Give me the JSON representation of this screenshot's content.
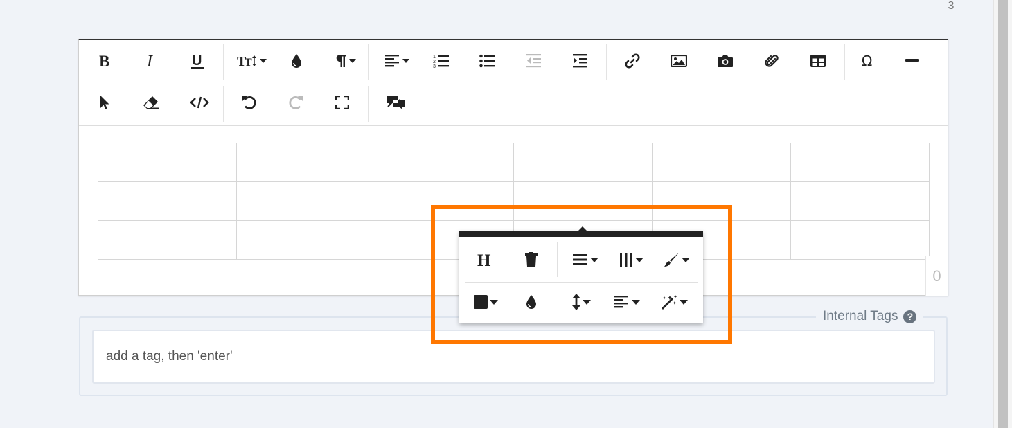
{
  "page": {
    "corner_number": "3"
  },
  "toolbar": {
    "row1": [
      {
        "icon": "bold-icon"
      },
      {
        "icon": "italic-icon"
      },
      {
        "icon": "underline-icon"
      },
      {
        "icon": "font-size-icon",
        "dropdown": true
      },
      {
        "icon": "color-drop-icon"
      },
      {
        "icon": "paragraph-icon",
        "dropdown": true
      },
      {
        "icon": "align-left-icon",
        "dropdown": true
      },
      {
        "icon": "ordered-list-icon"
      },
      {
        "icon": "unordered-list-icon"
      },
      {
        "icon": "outdent-icon",
        "disabled": true
      },
      {
        "icon": "indent-icon"
      },
      {
        "icon": "link-icon"
      },
      {
        "icon": "image-icon"
      },
      {
        "icon": "camera-icon"
      },
      {
        "icon": "paperclip-icon"
      },
      {
        "icon": "table-icon"
      },
      {
        "icon": "omega-icon"
      },
      {
        "icon": "horizontal-rule-icon"
      }
    ],
    "row2": [
      {
        "icon": "cursor-icon"
      },
      {
        "icon": "eraser-icon"
      },
      {
        "icon": "code-view-icon"
      },
      {
        "icon": "undo-icon"
      },
      {
        "icon": "redo-icon",
        "disabled": true
      },
      {
        "icon": "fullscreen-icon"
      },
      {
        "icon": "video-chat-icon"
      }
    ]
  },
  "editor": {
    "char_counter": "0",
    "table_rows": 3,
    "table_cols": 6
  },
  "table_popover": {
    "row1": [
      {
        "icon": "header-icon"
      },
      {
        "icon": "trash-icon"
      },
      {
        "icon": "rows-icon",
        "dropdown": true
      },
      {
        "icon": "columns-icon",
        "dropdown": true
      },
      {
        "icon": "brush-icon",
        "dropdown": true
      }
    ],
    "row2": [
      {
        "icon": "cell-background-icon",
        "dropdown": true
      },
      {
        "icon": "color-drop-icon"
      },
      {
        "icon": "vertical-align-icon",
        "dropdown": true
      },
      {
        "icon": "horizontal-align-icon",
        "dropdown": true
      },
      {
        "icon": "magic-wand-icon",
        "dropdown": true
      }
    ]
  },
  "tags": {
    "legend": "Internal Tags",
    "help_glyph": "?",
    "placeholder": "add a tag, then 'enter'",
    "value": ""
  },
  "colors": {
    "highlight": "#ff7700",
    "page_bg": "#f0f3f8",
    "popover_bar": "#222222"
  }
}
